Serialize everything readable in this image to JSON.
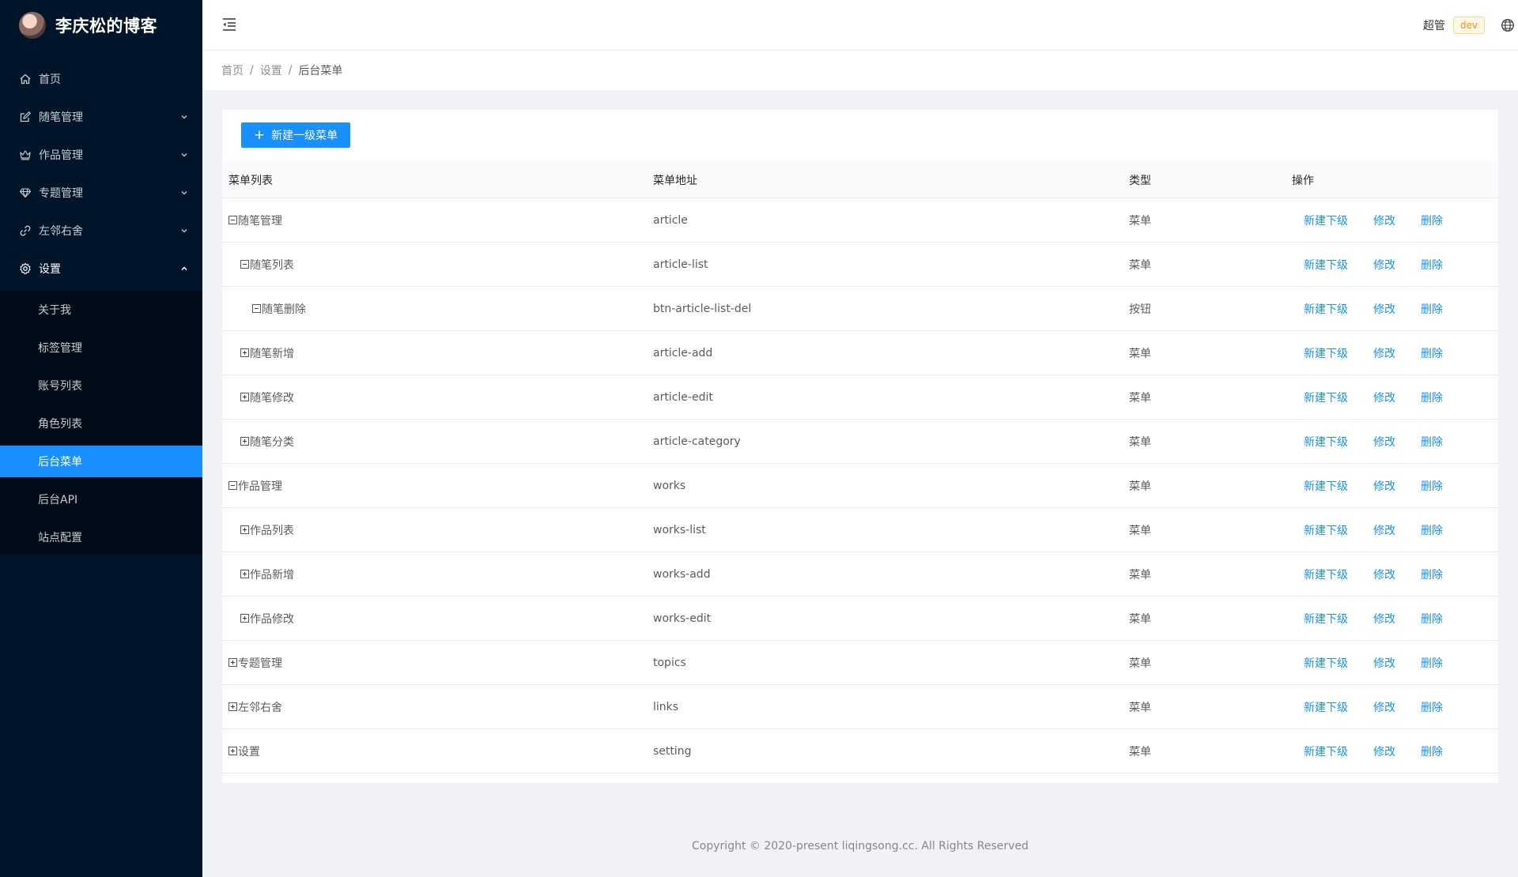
{
  "sidebar": {
    "title": "李庆松的博客",
    "items": [
      {
        "label": "首页",
        "icon": "home-icon",
        "expandable": false
      },
      {
        "label": "随笔管理",
        "icon": "edit-icon",
        "expandable": true
      },
      {
        "label": "作品管理",
        "icon": "crown-icon",
        "expandable": true
      },
      {
        "label": "专题管理",
        "icon": "gem-icon",
        "expandable": true
      },
      {
        "label": "左邻右舍",
        "icon": "link-icon",
        "expandable": true
      },
      {
        "label": "设置",
        "icon": "gear-icon",
        "expandable": true,
        "open": true
      }
    ],
    "settings_children": [
      {
        "label": "关于我"
      },
      {
        "label": "标签管理"
      },
      {
        "label": "账号列表"
      },
      {
        "label": "角色列表"
      },
      {
        "label": "后台菜单",
        "active": true
      },
      {
        "label": "后台API"
      },
      {
        "label": "站点配置"
      }
    ]
  },
  "header": {
    "user": "超管",
    "env": "dev"
  },
  "breadcrumb": [
    "首页",
    "设置",
    "后台菜单"
  ],
  "toolbar": {
    "new_button": "新建一级菜单"
  },
  "table": {
    "columns": [
      "菜单列表",
      "菜单地址",
      "类型",
      "操作"
    ],
    "ops": [
      "新建下级",
      "修改",
      "删除"
    ],
    "rows": [
      {
        "name": "随笔管理",
        "path": "article",
        "type": "菜单",
        "level": 0,
        "expanded": true
      },
      {
        "name": "随笔列表",
        "path": "article-list",
        "type": "菜单",
        "level": 1,
        "expanded": true
      },
      {
        "name": "随笔删除",
        "path": "btn-article-list-del",
        "type": "按钮",
        "level": 2,
        "expanded": true
      },
      {
        "name": "随笔新增",
        "path": "article-add",
        "type": "菜单",
        "level": 1,
        "expanded": false
      },
      {
        "name": "随笔修改",
        "path": "article-edit",
        "type": "菜单",
        "level": 1,
        "expanded": false
      },
      {
        "name": "随笔分类",
        "path": "article-category",
        "type": "菜单",
        "level": 1,
        "expanded": false
      },
      {
        "name": "作品管理",
        "path": "works",
        "type": "菜单",
        "level": 0,
        "expanded": true
      },
      {
        "name": "作品列表",
        "path": "works-list",
        "type": "菜单",
        "level": 1,
        "expanded": false
      },
      {
        "name": "作品新增",
        "path": "works-add",
        "type": "菜单",
        "level": 1,
        "expanded": false
      },
      {
        "name": "作品修改",
        "path": "works-edit",
        "type": "菜单",
        "level": 1,
        "expanded": false
      },
      {
        "name": "专题管理",
        "path": "topics",
        "type": "菜单",
        "level": 0,
        "expanded": false
      },
      {
        "name": "左邻右舍",
        "path": "links",
        "type": "菜单",
        "level": 0,
        "expanded": false
      },
      {
        "name": "设置",
        "path": "setting",
        "type": "菜单",
        "level": 0,
        "expanded": false
      }
    ]
  },
  "footer": {
    "text": "Copyright © 2020-present liqingsong.cc. All Rights Reserved"
  },
  "colors": {
    "sidebar_bg": "#001529",
    "submenu_bg": "#000c17",
    "primary": "#1890ff"
  }
}
